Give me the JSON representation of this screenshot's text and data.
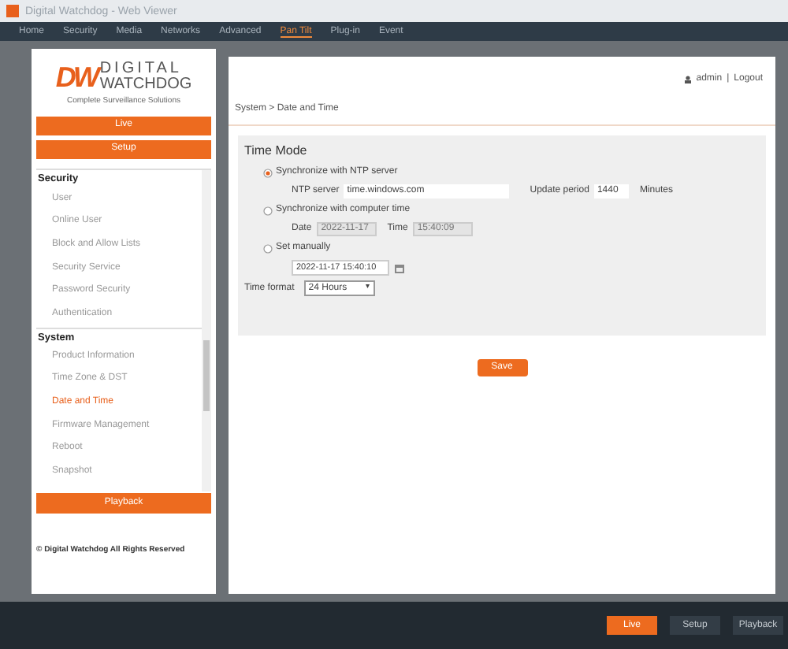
{
  "window": {
    "title": "Digital Watchdog - Web Viewer"
  },
  "menu": [
    {
      "label": "Home",
      "selected": false
    },
    {
      "label": "Security",
      "selected": false
    },
    {
      "label": "Media",
      "selected": false
    },
    {
      "label": "Networks",
      "selected": false
    },
    {
      "label": "Advanced",
      "selected": false
    },
    {
      "label": "Pan Tilt",
      "selected": true
    },
    {
      "label": "Plug-in",
      "selected": false
    },
    {
      "label": "Event",
      "selected": false
    }
  ],
  "sidebar": {
    "logo": {
      "mark": "DW",
      "brand_top": "DIGITAL",
      "brand_bottom": "WATCHDOG",
      "tagline": "Complete Surveillance Solutions"
    },
    "buttons": [
      "Live",
      "Setup"
    ],
    "sections": [
      {
        "title": "Security",
        "items": [
          {
            "label": "User",
            "selected": false
          },
          {
            "label": "Online User",
            "selected": false
          },
          {
            "label": "Block and Allow Lists",
            "selected": false
          },
          {
            "label": "Security Service",
            "selected": false
          },
          {
            "label": "Password Security",
            "selected": false
          },
          {
            "label": "Authentication",
            "selected": false
          }
        ]
      },
      {
        "title": "System",
        "items": [
          {
            "label": "Product Information",
            "selected": false
          },
          {
            "label": "Time Zone & DST",
            "selected": false
          },
          {
            "label": "Date and Time",
            "selected": true
          },
          {
            "label": "Firmware Management",
            "selected": false
          },
          {
            "label": "Reboot",
            "selected": false
          },
          {
            "label": "Snapshot",
            "selected": false
          }
        ]
      }
    ],
    "playback_button": "Playback",
    "copyright": "© Digital Watchdog All Rights Reserved"
  },
  "header": {
    "user": "admin",
    "separator": "|",
    "logout": "Logout",
    "breadcrumb": "System > Date and Time"
  },
  "time_mode": {
    "title": "Time Mode",
    "options": [
      {
        "label": "Synchronize with NTP server",
        "selected": true
      },
      {
        "label": "Synchronize with computer time",
        "selected": false
      },
      {
        "label": "Set manually",
        "selected": false
      }
    ],
    "ntp_label": "NTP server",
    "ntp_value": "time.windows.com",
    "period_label": "Update period",
    "period_value": "1440",
    "period_unit": "Minutes",
    "date_label": "Date",
    "date_value": "2022-11-17",
    "time_label": "Time",
    "time_value": "15:40:09",
    "manual_value": "2022-11-17 15:40:10",
    "format_label": "Time format",
    "format_value": "24 Hours",
    "format_caret": "▾"
  },
  "save": "Save",
  "footer_buttons": [
    {
      "label": "Live",
      "selected": true
    },
    {
      "label": "Setup",
      "selected": false
    },
    {
      "label": "Playback",
      "selected": false
    }
  ]
}
